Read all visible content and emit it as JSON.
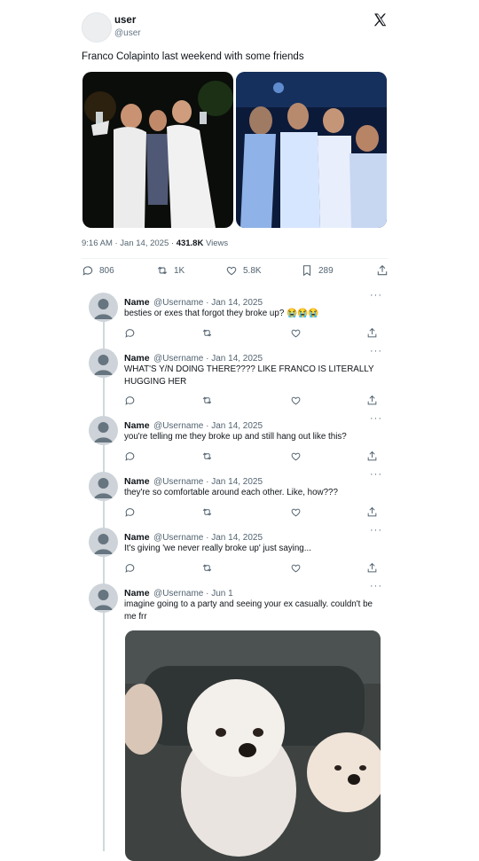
{
  "post": {
    "author_name": "user",
    "author_handle": "@user",
    "text": "Franco Colapinto last weekend with some friends",
    "time": "9:16 AM · Jan 14, 2025 ·",
    "views_count": "431.8K",
    "views_label": "Views",
    "replies": "806",
    "reposts": "1K",
    "likes": "5.8K",
    "bookmarks": "289"
  },
  "replies": [
    {
      "name": "Name",
      "handle": "@Username · Jan 14, 2025",
      "text": "besties or exes that forgot they broke up? 😭😭😭"
    },
    {
      "name": "Name",
      "handle": "@Username · Jan 14, 2025",
      "text": "WHAT'S Y/N DOING THERE???? LIKE FRANCO IS LITERALLY HUGGING HER"
    },
    {
      "name": "Name",
      "handle": "@Username · Jan 14, 2025",
      "text": "you're telling me they broke up and still hang out like this?"
    },
    {
      "name": "Name",
      "handle": "@Username · Jan 14, 2025",
      "text": "they're so comfortable around each other. Like, how???"
    },
    {
      "name": "Name",
      "handle": "@Username · Jan 14, 2025",
      "text": "It's giving 'we never really broke up' just saying..."
    },
    {
      "name": "Name",
      "handle": "@Username · Jun 1",
      "text": "imagine going to a party and seeing your ex casually. couldn't be me frr"
    }
  ],
  "more_label": "···",
  "icons": {
    "logo": "x-logo-icon",
    "reply": "reply-icon",
    "repost": "repost-icon",
    "like": "heart-icon",
    "bookmark": "bookmark-icon",
    "share": "share-icon"
  }
}
